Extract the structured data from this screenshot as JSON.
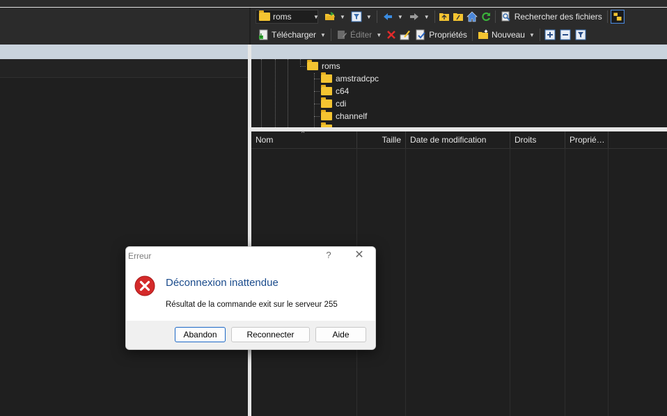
{
  "toolbar": {
    "path_value": "roms",
    "search_label": "Rechercher des fichiers",
    "download_label": "Télécharger",
    "edit_label": "Éditer",
    "properties_label": "Propriétés",
    "new_label": "Nouveau",
    "icons": [
      "folder-icon",
      "open-folder-icon",
      "filter-icon",
      "back-arrow-icon",
      "forward-arrow-icon",
      "parent-dir-icon",
      "root-dir-icon",
      "home-icon",
      "refresh-icon",
      "find-files-icon",
      "tree-toggle-icon",
      "download-icon",
      "edit-icon",
      "delete-icon",
      "rename-icon",
      "properties-icon",
      "new-folder-icon",
      "plus-icon",
      "minus-icon",
      "filter-icon"
    ]
  },
  "tree": {
    "root": "roms",
    "children": [
      "amstradcpc",
      "c64",
      "cdi",
      "channelf"
    ]
  },
  "file_list": {
    "columns": [
      "Nom",
      "Taille",
      "Date de modification",
      "Droits",
      "Proprié…"
    ]
  },
  "dialog": {
    "title": "Erreur",
    "help_glyph": "?",
    "close_glyph": "✕",
    "heading": "Déconnexion inattendue",
    "message": "Résultat de la commande exit sur le serveur 255",
    "buttons": {
      "abort": "Abandon",
      "reconnect": "Reconnecter",
      "help": "Aide"
    }
  },
  "colors": {
    "panel_bg": "#1f1f1f",
    "header_bg": "#c9d3dd",
    "folder": "#f4c431",
    "error_red": "#d42a2a",
    "heading_blue": "#1a4b8c"
  }
}
